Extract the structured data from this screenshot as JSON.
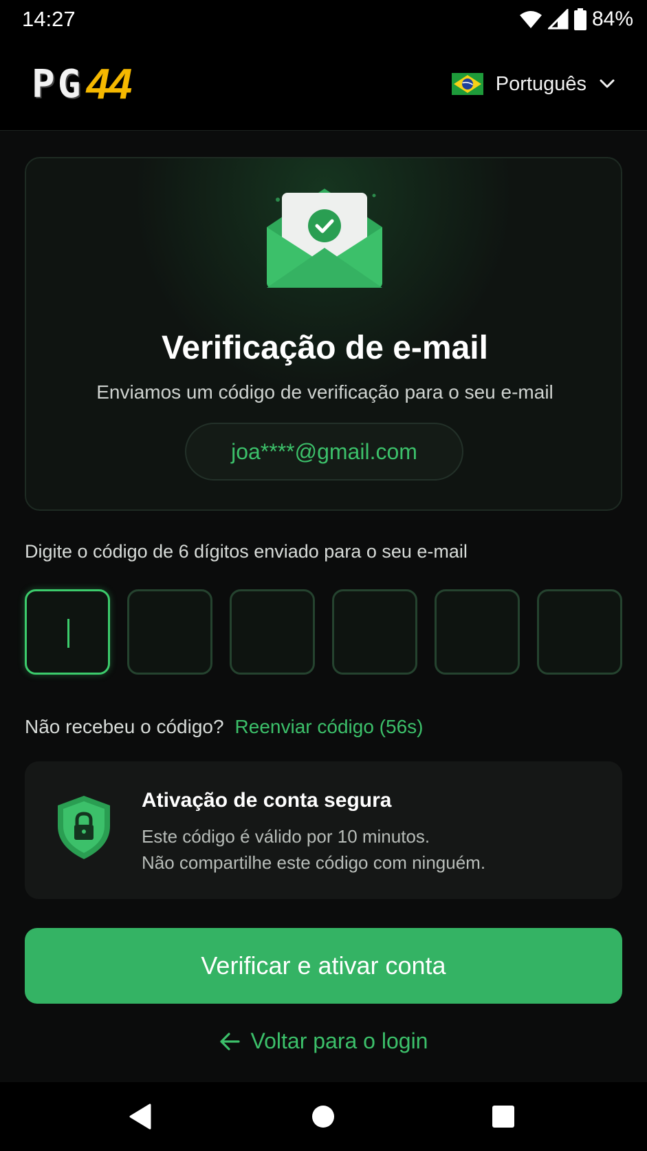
{
  "status_bar": {
    "time": "14:27",
    "battery": "84%",
    "icons": [
      "wifi-icon",
      "signal-icon",
      "battery-icon"
    ]
  },
  "header": {
    "logo_text_pg": "PG",
    "logo_text_num": "44",
    "language": {
      "label": "Português",
      "flag": "brazil-flag-icon"
    }
  },
  "verify_card": {
    "icon": "envelope-check-icon",
    "title": "Verificação de e-mail",
    "subtitle": "Enviamos um código de verificação para o seu e-mail",
    "email": "joa****@gmail.com"
  },
  "code_entry": {
    "label": "Digite o código de 6 dígitos enviado para o seu e-mail",
    "digits": [
      "",
      "",
      "",
      "",
      "",
      ""
    ],
    "active_index": 0
  },
  "resend": {
    "question": "Não recebeu o código?",
    "link": "Reenviar código (56s)"
  },
  "secure_info": {
    "icon": "shield-lock-icon",
    "title": "Ativação de conta segura",
    "line1": "Este código é válido por 10 minutos.",
    "line2": "Não compartilhe este código com ninguém."
  },
  "actions": {
    "verify_label": "Verificar e ativar conta",
    "back_label": "Voltar para o login"
  },
  "colors": {
    "accent": "#34b364",
    "link": "#3cc06a",
    "logo_yellow": "#f5b800",
    "background": "#0b0c0c"
  },
  "nav": [
    "back-triangle-icon",
    "home-circle-icon",
    "recents-square-icon"
  ]
}
